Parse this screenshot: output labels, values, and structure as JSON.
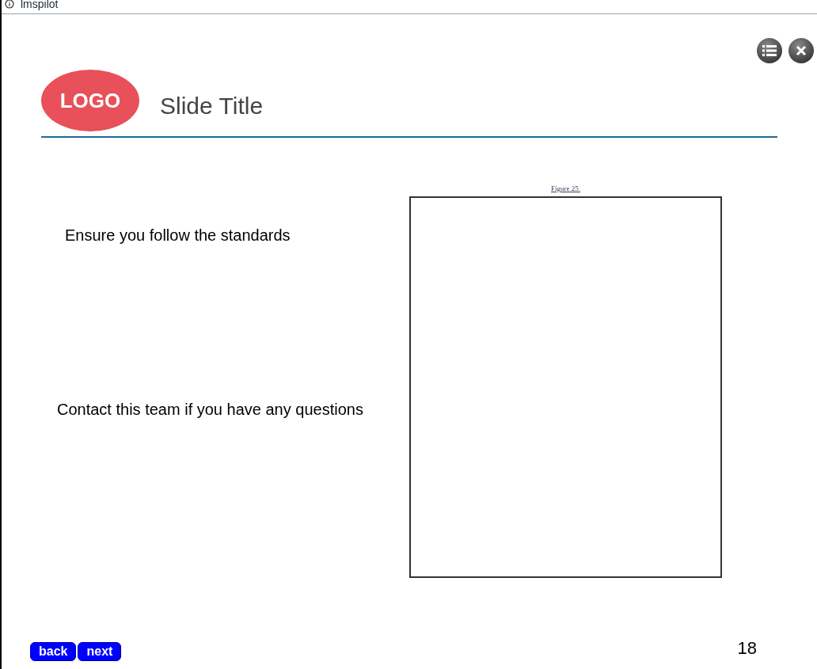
{
  "window": {
    "title": "lmspilot"
  },
  "slide": {
    "logo": "LOGO",
    "title": "Slide Title",
    "figure_caption": "Figure 25.",
    "bullets": [
      "Ensure you follow the standards",
      "Contact this team if you have any questions"
    ],
    "page_number": "18"
  },
  "nav": [
    "back",
    "next"
  ]
}
